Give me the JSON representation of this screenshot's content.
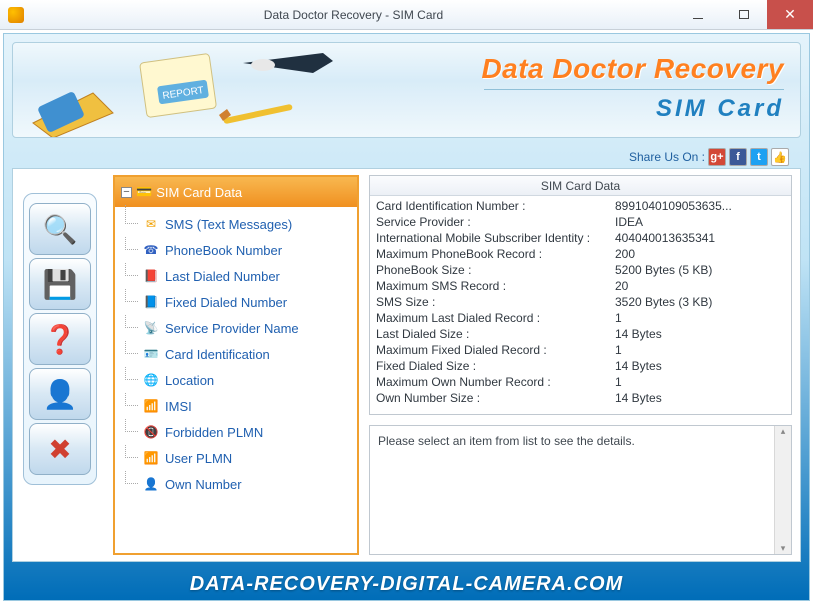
{
  "window": {
    "title": "Data Doctor Recovery - SIM Card"
  },
  "banner": {
    "title": "Data Doctor Recovery",
    "subtitle": "SIM Card"
  },
  "share": {
    "label": "Share Us On :"
  },
  "tree": {
    "root": "SIM Card Data",
    "items": [
      {
        "label": "SMS (Text Messages)",
        "icon": "✉",
        "color": "#f0a000"
      },
      {
        "label": "PhoneBook Number",
        "icon": "☎",
        "color": "#3060c0"
      },
      {
        "label": "Last Dialed Number",
        "icon": "📕",
        "color": "#d04030"
      },
      {
        "label": "Fixed Dialed Number",
        "icon": "📘",
        "color": "#3060c0"
      },
      {
        "label": "Service Provider Name",
        "icon": "📡",
        "color": "#40a0e0"
      },
      {
        "label": "Card Identification",
        "icon": "🪪",
        "color": "#888"
      },
      {
        "label": "Location",
        "icon": "🌐",
        "color": "#4080c0"
      },
      {
        "label": "IMSI",
        "icon": "📶",
        "color": "#d07030"
      },
      {
        "label": "Forbidden PLMN",
        "icon": "📵",
        "color": "#c04030"
      },
      {
        "label": "User PLMN",
        "icon": "📶",
        "color": "#c04030"
      },
      {
        "label": "Own Number",
        "icon": "👤",
        "color": "#e09030"
      }
    ]
  },
  "table": {
    "header": "SIM Card Data",
    "rows": [
      {
        "k": "Card Identification Number :",
        "v": "8991040109053635..."
      },
      {
        "k": "Service Provider :",
        "v": "IDEA"
      },
      {
        "k": "International Mobile Subscriber Identity :",
        "v": "404040013635341"
      },
      {
        "k": "Maximum PhoneBook Record :",
        "v": "200"
      },
      {
        "k": "PhoneBook Size :",
        "v": "5200 Bytes (5 KB)"
      },
      {
        "k": "Maximum SMS Record :",
        "v": "20"
      },
      {
        "k": "SMS Size :",
        "v": "3520 Bytes (3 KB)"
      },
      {
        "k": "Maximum Last Dialed Record :",
        "v": "1"
      },
      {
        "k": "Last Dialed Size :",
        "v": "14 Bytes"
      },
      {
        "k": "Maximum Fixed Dialed Record :",
        "v": "1"
      },
      {
        "k": "Fixed Dialed Size :",
        "v": "14 Bytes"
      },
      {
        "k": "Maximum Own Number Record :",
        "v": "1"
      },
      {
        "k": "Own Number Size :",
        "v": "14 Bytes"
      }
    ]
  },
  "details": {
    "placeholder": "Please select an item from list to see the details."
  },
  "footer": {
    "url": "DATA-RECOVERY-DIGITAL-CAMERA.COM"
  },
  "toolbar": {
    "buttons": [
      {
        "name": "search-sim",
        "glyph": "🔍"
      },
      {
        "name": "save",
        "glyph": "💾"
      },
      {
        "name": "help",
        "glyph": "❓"
      },
      {
        "name": "user",
        "glyph": "👤"
      },
      {
        "name": "close",
        "glyph": "✖"
      }
    ]
  }
}
